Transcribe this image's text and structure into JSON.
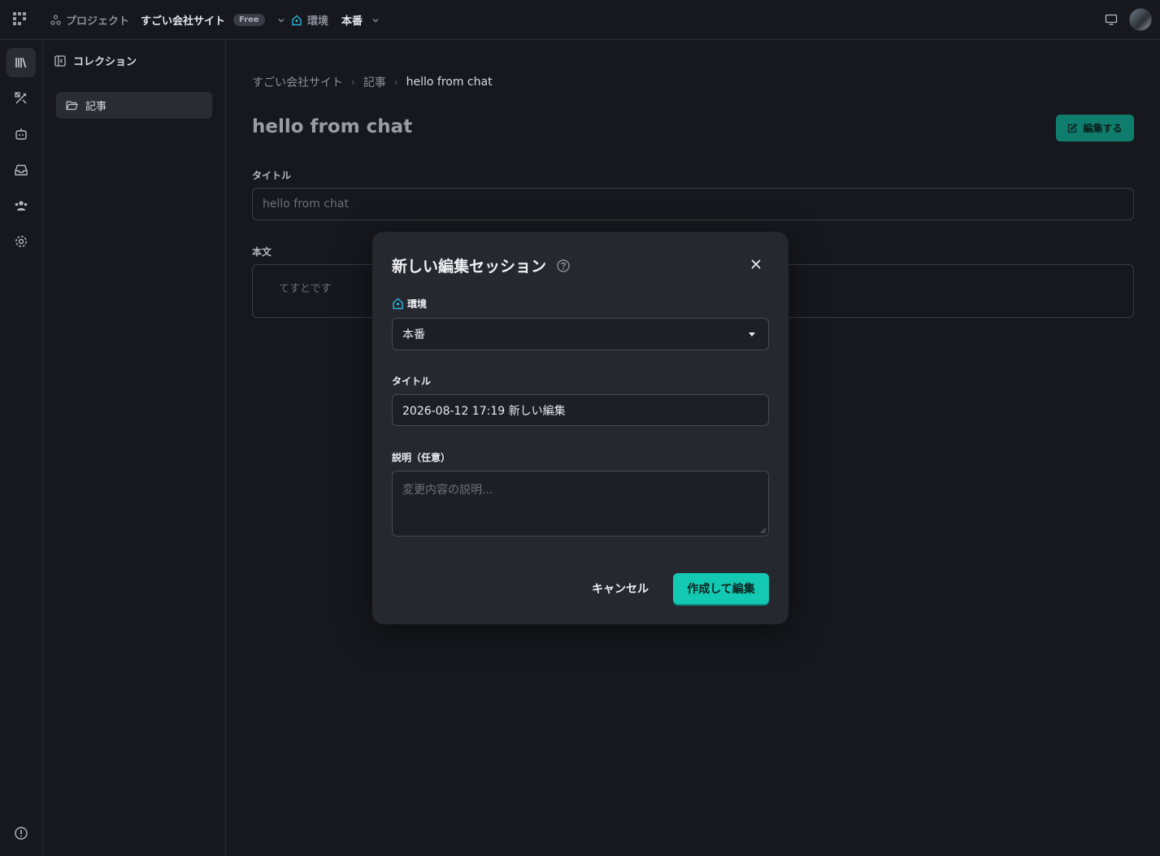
{
  "header": {
    "project_label": "プロジェクト",
    "project_name": "すごい会社サイト",
    "plan_badge": "Free",
    "env_label": "環境",
    "env_value": "本番"
  },
  "rail": {
    "items": [
      "library-icon",
      "design-icon",
      "bot-icon",
      "inbox-icon",
      "users-icon",
      "settings-icon"
    ],
    "footer": "feedback-icon"
  },
  "sidebar": {
    "heading": "コレクション",
    "items": [
      {
        "label": "記事"
      }
    ]
  },
  "main": {
    "breadcrumb": [
      "すごい会社サイト",
      "記事",
      "hello from chat"
    ],
    "title": "hello from chat",
    "edit_button": "編集する",
    "fields": [
      {
        "label": "タイトル",
        "value": "hello from chat"
      },
      {
        "label": "本文",
        "value": "てすとです"
      }
    ]
  },
  "modal": {
    "title": "新しい編集セッション",
    "env_label": "環境",
    "env_value": "本番",
    "title_label": "タイトル",
    "title_value": "2026-08-12 17:19 新しい編集",
    "desc_label": "説明（任意）",
    "desc_placeholder": "変更内容の説明...",
    "cancel": "キャンセル",
    "submit": "作成して編集"
  },
  "colors": {
    "accent": "#13c9b3",
    "env_icon": "#2bb6d8"
  }
}
